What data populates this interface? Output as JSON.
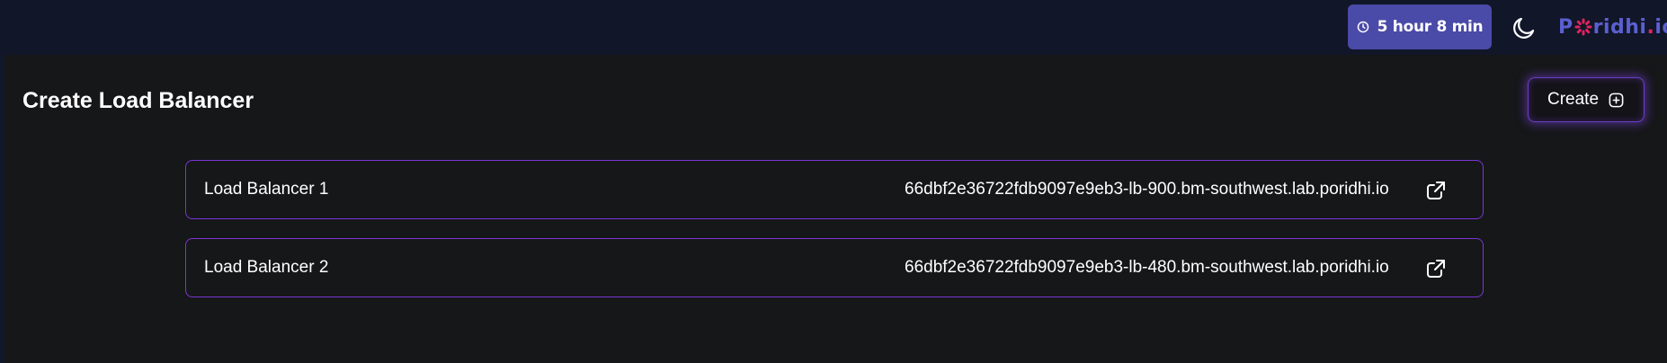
{
  "header": {
    "timer": {
      "icon": "clock-icon",
      "label": "5 hour 8 min",
      "color": "#4a4aa8"
    },
    "theme_toggle": {
      "icon": "moon-icon"
    },
    "logo": {
      "text_before": "P",
      "text_after": "ridhi",
      "dot": ".",
      "tld": "io",
      "colors": {
        "primary": "#5b5fd0",
        "accent": "#e0245e"
      }
    }
  },
  "main": {
    "title": "Create Load Balancer",
    "create_button": {
      "label": "Create",
      "icon": "plus-circle-icon"
    },
    "load_balancers": [
      {
        "name": "Load Balancer 1",
        "url": "66dbf2e36722fdb9097e9eb3-lb-900.bm-southwest.lab.poridhi.io",
        "icon": "external-link-icon"
      },
      {
        "name": "Load Balancer 2",
        "url": "66dbf2e36722fdb9097e9eb3-lb-480.bm-southwest.lab.poridhi.io",
        "icon": "external-link-icon"
      }
    ]
  },
  "colors": {
    "background": "#11182a",
    "panel": "#161719",
    "row_border": "#7a36d6"
  }
}
